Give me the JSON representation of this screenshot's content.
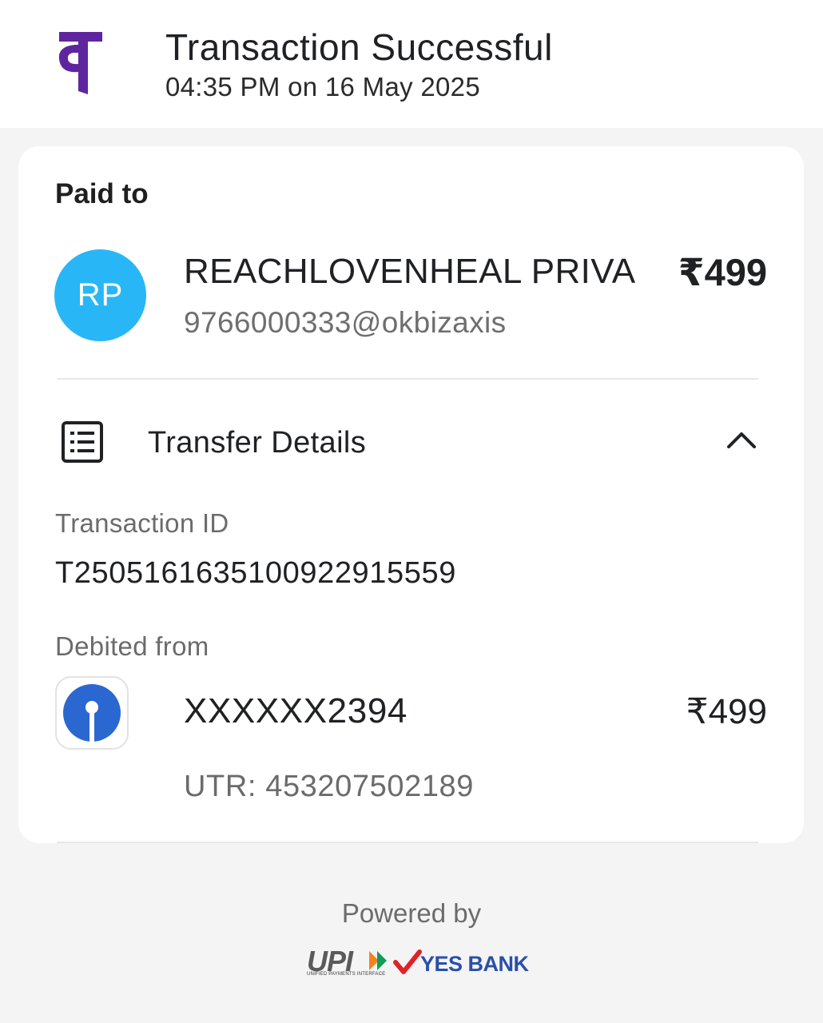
{
  "header": {
    "logo_icon": "phonepe-logo",
    "brand_color": "#5f259f",
    "title": "Transaction Successful",
    "timestamp": "04:35 PM on 16 May 2025"
  },
  "payment": {
    "paid_to_label": "Paid to",
    "avatar_initials": "RP",
    "avatar_color": "#29b6f6",
    "payee_name": "REACHLOVENHEAL PRIVA",
    "amount": "₹499",
    "upi_id": "9766000333@okbizaxis"
  },
  "transfer_details": {
    "icon": "list-icon",
    "title": "Transfer Details",
    "toggle_icon": "chevron-up-icon",
    "transaction_id_label": "Transaction ID",
    "transaction_id": "T2505161635100922915559",
    "debited_from_label": "Debited from",
    "bank_icon": "sbi-logo",
    "account": "XXXXXX2394",
    "debit_amount": "₹499",
    "utr": "UTR: 453207502189"
  },
  "footer": {
    "powered_by": "Powered by",
    "upi_brand": "UPI",
    "upi_subtitle": "UNIFIED PAYMENTS INTERFACE",
    "bank_brand": "YES BANK"
  }
}
